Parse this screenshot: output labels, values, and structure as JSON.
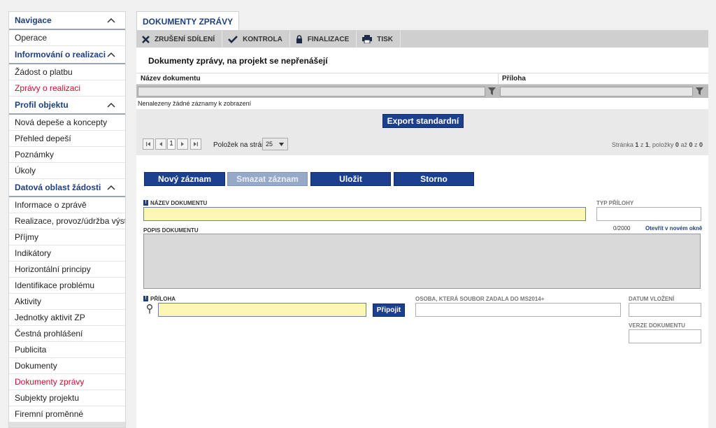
{
  "sidebar": {
    "sections": [
      {
        "title": "Navigace",
        "items": [
          {
            "label": "Operace",
            "active": false
          }
        ]
      },
      {
        "title": "Informování o realizaci",
        "items": [
          {
            "label": "Žádost o platbu",
            "active": false
          },
          {
            "label": "Zprávy o realizaci",
            "active": true
          }
        ]
      },
      {
        "title": "Profil objektu",
        "items": [
          {
            "label": "Nová depeše a koncepty",
            "active": false
          },
          {
            "label": "Přehled depeší",
            "active": false
          },
          {
            "label": "Poznámky",
            "active": false
          },
          {
            "label": "Úkoly",
            "active": false
          }
        ]
      },
      {
        "title": "Datová oblast žádosti",
        "items": [
          {
            "label": "Informace o zprávě",
            "active": false
          },
          {
            "label": "Realizace, provoz/údržba výstupu",
            "active": false
          },
          {
            "label": "Příjmy",
            "active": false
          },
          {
            "label": "Indikátory",
            "active": false
          },
          {
            "label": "Horizontální principy",
            "active": false
          },
          {
            "label": "Identifikace problému",
            "active": false
          },
          {
            "label": "Aktivity",
            "active": false
          },
          {
            "label": "Jednotky aktivit ZP",
            "active": false
          },
          {
            "label": "Čestná prohlášení",
            "active": false
          },
          {
            "label": "Publicita",
            "active": false
          },
          {
            "label": "Dokumenty",
            "active": false
          },
          {
            "label": "Dokumenty zprávy",
            "active": true
          },
          {
            "label": "Subjekty projektu",
            "active": false
          },
          {
            "label": "Firemní proměnné",
            "active": false
          }
        ]
      }
    ]
  },
  "tab": {
    "label": "DOKUMENTY ZPRÁVY"
  },
  "toolbar": {
    "cancel_share": "ZRUŠENÍ SDÍLENÍ",
    "check": "KONTROLA",
    "finalize": "FINALIZACE",
    "print": "TISK"
  },
  "section_title": "Dokumenty zprávy, na projekt se nepřenášejí",
  "grid": {
    "columns": [
      "Název dokumentu",
      "Příloha"
    ],
    "empty_message": "Nenalezeny žádné záznamy k zobrazení",
    "export_label": "Export standardní"
  },
  "pager": {
    "page": "1",
    "per_page_label": "Položek na stránku",
    "per_page_value": "25",
    "info_prefix": "Stránka ",
    "info_page": "1",
    "info_of": " z ",
    "info_pages": "1",
    "info_items": ", položky ",
    "info_from": "0",
    "info_to_word": " až ",
    "info_to": "0",
    "info_total_word": " z ",
    "info_total": "0"
  },
  "actions": {
    "new": "Nový záznam",
    "delete": "Smazat záznam",
    "save": "Uložit",
    "cancel": "Storno"
  },
  "form": {
    "name_label": "NÁZEV DOKUMENTU",
    "type_label": "TYP PŘÍLOHY",
    "desc_label": "POPIS DOKUMENTU",
    "desc_counter": "0/2000",
    "open_new_window": "Otevřít v novém okně",
    "attachment_label": "PŘÍLOHA",
    "attach_button": "Připojit",
    "person_label": "OSOBA, KTERÁ SOUBOR ZADALA DO MS2014+",
    "date_label": "DATUM VLOŽENÍ",
    "version_label": "VERZE DOKUMENTU",
    "required_marker": "!"
  },
  "colors": {
    "brand_blue": "#1d3f8f",
    "active_red": "#c8102e",
    "required_yellow": "#fcf6b6"
  }
}
